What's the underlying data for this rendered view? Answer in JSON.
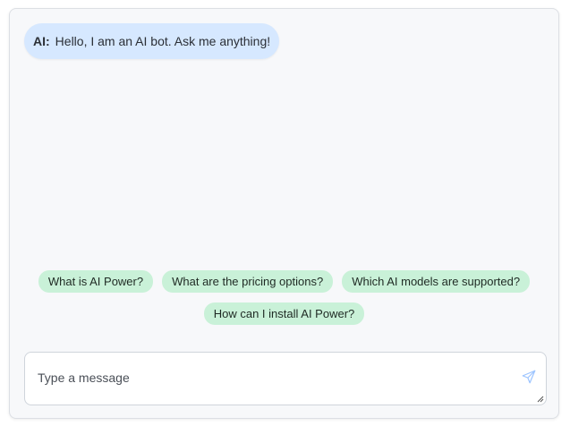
{
  "messages": [
    {
      "sender": "AI:",
      "text": "Hello, I am an AI bot. Ask me anything!"
    }
  ],
  "suggestions": [
    "What is AI Power?",
    "What are the pricing options?",
    "Which AI models are supported?",
    "How can I install AI Power?"
  ],
  "composer": {
    "placeholder": "Type a message",
    "value": ""
  },
  "colors": {
    "ai_bubble": "#d6e8ff",
    "chip": "#c9f1d8",
    "send_icon": "#9cc4ff"
  },
  "icons": {
    "send": "send-icon"
  }
}
